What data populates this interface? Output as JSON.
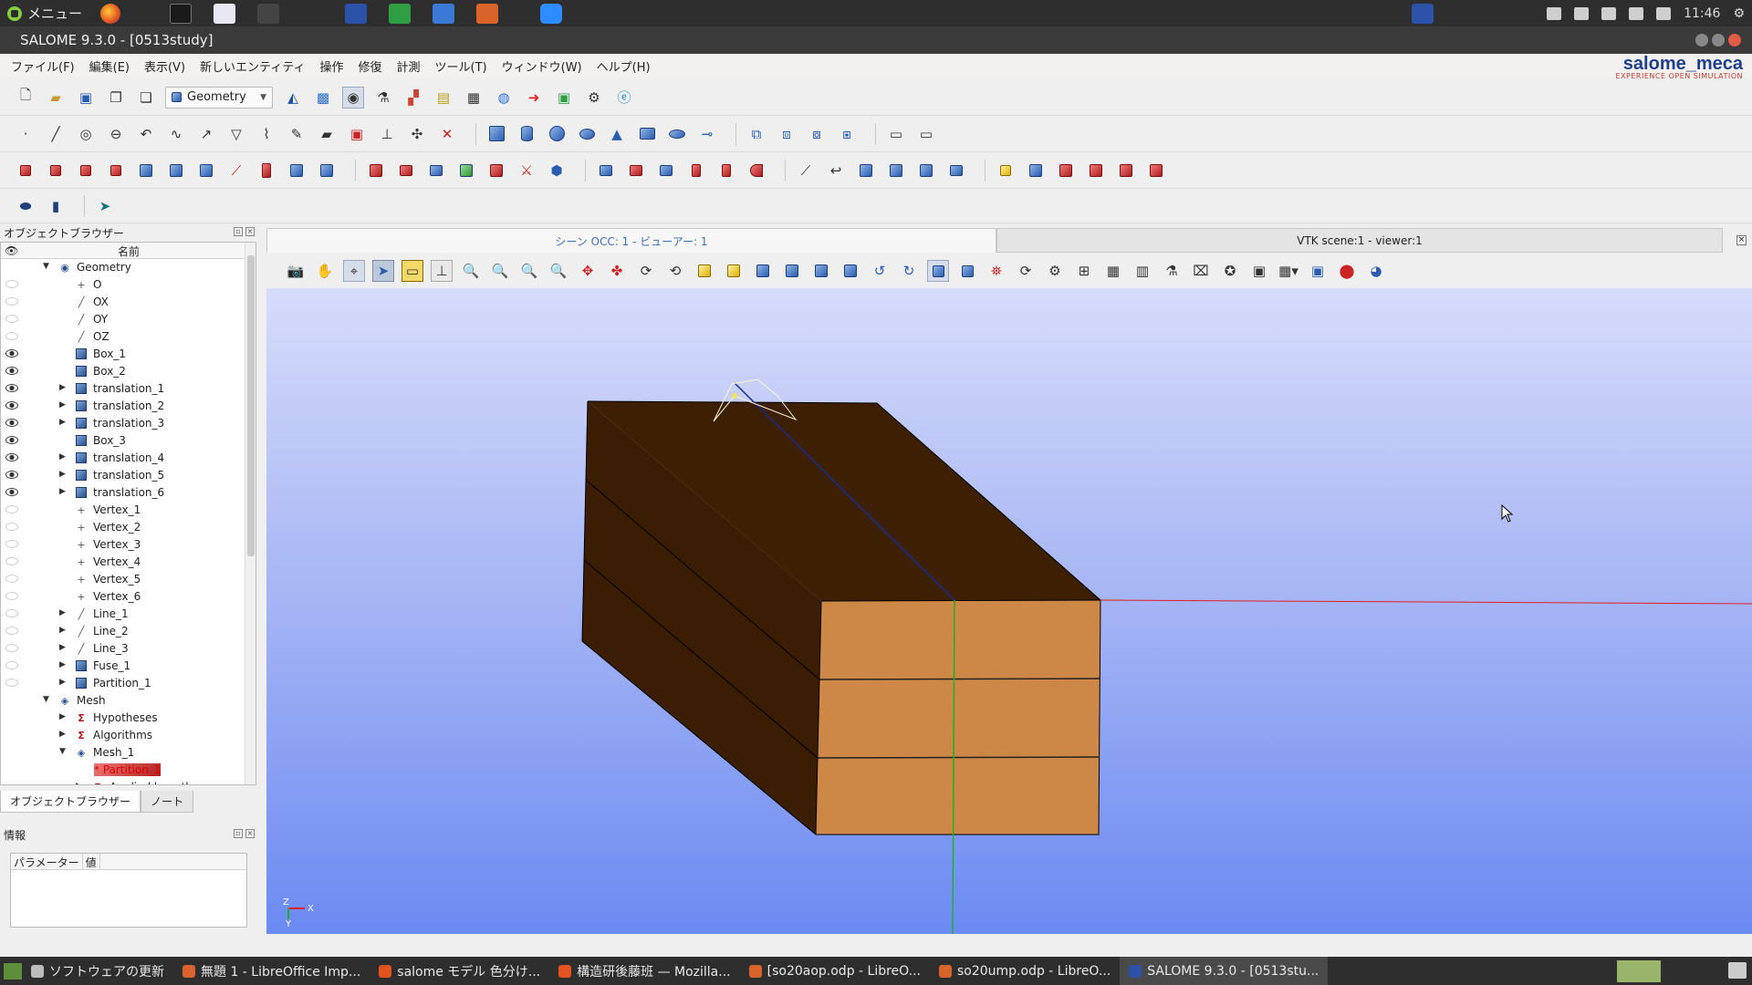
{
  "top_panel": {
    "menu_label": "メニュー",
    "clock": "11:46"
  },
  "window": {
    "title": "SALOME 9.3.0 - [0513study]"
  },
  "menubar": {
    "items": [
      "ファイル(F)",
      "編集(E)",
      "表示(V)",
      "新しいエンティティ",
      "操作",
      "修復",
      "計測",
      "ツール(T)",
      "ウィンドウ(W)",
      "ヘルプ(H)"
    ]
  },
  "brand": {
    "name": "salome_meca",
    "tagline": "EXPERIENCE OPEN SIMULATION"
  },
  "toolbar": {
    "module_combo_value": "Geometry"
  },
  "object_browser": {
    "title": "オブジェクトブラウザー",
    "column_name": "名前",
    "rows": [
      {
        "label": "Geometry",
        "level": 0,
        "expander": "open",
        "icon": "geometry-icon",
        "visible": "none"
      },
      {
        "label": "O",
        "level": 1,
        "expander": "",
        "icon": "vertex-icon",
        "visible": "off"
      },
      {
        "label": "OX",
        "level": 1,
        "expander": "",
        "icon": "line-icon",
        "visible": "off"
      },
      {
        "label": "OY",
        "level": 1,
        "expander": "",
        "icon": "line-icon",
        "visible": "off"
      },
      {
        "label": "OZ",
        "level": 1,
        "expander": "",
        "icon": "line-icon",
        "visible": "off"
      },
      {
        "label": "Box_1",
        "level": 1,
        "expander": "",
        "icon": "solid-icon",
        "visible": "on"
      },
      {
        "label": "Box_2",
        "level": 1,
        "expander": "",
        "icon": "solid-icon",
        "visible": "on"
      },
      {
        "label": "translation_1",
        "level": 1,
        "expander": "closed",
        "icon": "solid-icon",
        "visible": "on"
      },
      {
        "label": "translation_2",
        "level": 1,
        "expander": "closed",
        "icon": "solid-icon",
        "visible": "on"
      },
      {
        "label": "translation_3",
        "level": 1,
        "expander": "closed",
        "icon": "solid-icon",
        "visible": "on"
      },
      {
        "label": "Box_3",
        "level": 1,
        "expander": "",
        "icon": "solid-icon",
        "visible": "on"
      },
      {
        "label": "translation_4",
        "level": 1,
        "expander": "closed",
        "icon": "solid-icon",
        "visible": "on"
      },
      {
        "label": "translation_5",
        "level": 1,
        "expander": "closed",
        "icon": "solid-icon",
        "visible": "on"
      },
      {
        "label": "translation_6",
        "level": 1,
        "expander": "closed",
        "icon": "solid-icon",
        "visible": "on"
      },
      {
        "label": "Vertex_1",
        "level": 1,
        "expander": "",
        "icon": "vertex-icon",
        "visible": "off"
      },
      {
        "label": "Vertex_2",
        "level": 1,
        "expander": "",
        "icon": "vertex-icon",
        "visible": "off"
      },
      {
        "label": "Vertex_3",
        "level": 1,
        "expander": "",
        "icon": "vertex-icon",
        "visible": "off"
      },
      {
        "label": "Vertex_4",
        "level": 1,
        "expander": "",
        "icon": "vertex-icon",
        "visible": "off"
      },
      {
        "label": "Vertex_5",
        "level": 1,
        "expander": "",
        "icon": "vertex-icon",
        "visible": "off"
      },
      {
        "label": "Vertex_6",
        "level": 1,
        "expander": "",
        "icon": "vertex-icon",
        "visible": "off"
      },
      {
        "label": "Line_1",
        "level": 1,
        "expander": "closed",
        "icon": "line-icon",
        "visible": "off"
      },
      {
        "label": "Line_2",
        "level": 1,
        "expander": "closed",
        "icon": "line-icon",
        "visible": "off"
      },
      {
        "label": "Line_3",
        "level": 1,
        "expander": "closed",
        "icon": "line-icon",
        "visible": "off"
      },
      {
        "label": "Fuse_1",
        "level": 1,
        "expander": "closed",
        "icon": "solid-icon",
        "visible": "off"
      },
      {
        "label": "Partition_1",
        "level": 1,
        "expander": "closed",
        "icon": "solid-icon",
        "visible": "off"
      },
      {
        "label": "Mesh",
        "level": 0,
        "expander": "open",
        "icon": "mesh-module-icon",
        "visible": "none"
      },
      {
        "label": "Hypotheses",
        "level": 1,
        "expander": "closed",
        "icon": "hypotheses-icon",
        "visible": "none"
      },
      {
        "label": "Algorithms",
        "level": 1,
        "expander": "closed",
        "icon": "algorithms-icon",
        "visible": "none"
      },
      {
        "label": "Mesh_1",
        "level": 1,
        "expander": "open",
        "icon": "mesh-icon",
        "visible": "none"
      },
      {
        "label": "* Partition_1",
        "level": 2,
        "expander": "",
        "icon": "",
        "visible": "none",
        "red": true
      },
      {
        "label": "Applied hypotheses",
        "level": 2,
        "expander": "closed",
        "icon": "hypotheses-icon",
        "visible": "none"
      }
    ],
    "tabs": [
      "オブジェクトブラウザー",
      "ノート"
    ]
  },
  "info_panel": {
    "title": "情報",
    "columns": [
      "パラメーター",
      "値"
    ]
  },
  "viewer": {
    "tabs": [
      "シーン OCC: 1 - ビューアー: 1",
      "VTK scene:1 - viewer:1"
    ],
    "triad_labels": {
      "z": "Z",
      "x": "X",
      "y": "Y"
    },
    "colors": {
      "top_face": "#3d1f04",
      "side_face": "#3b1d03",
      "front_face": "#cd8847",
      "x_axis": "#e02020",
      "y_axis": "#1fb31f",
      "z_axis": "#1a2a8a"
    }
  },
  "taskbar": {
    "tasks": [
      {
        "label": "ソフトウェアの更新",
        "icon": "update-icon"
      },
      {
        "label": "無題 1 - LibreOffice Imp...",
        "icon": "impress-icon"
      },
      {
        "label": "salome モデル 色分け...",
        "icon": "firefox-icon"
      },
      {
        "label": "構造研後藤班 — Mozilla...",
        "icon": "firefox-icon"
      },
      {
        "label": "[so20aop.odp - LibreO...",
        "icon": "impress-icon"
      },
      {
        "label": "so20ump.odp - LibreO...",
        "icon": "impress-icon"
      },
      {
        "label": "SALOME 9.3.0 - [0513stu...",
        "icon": "salome-icon"
      }
    ]
  }
}
